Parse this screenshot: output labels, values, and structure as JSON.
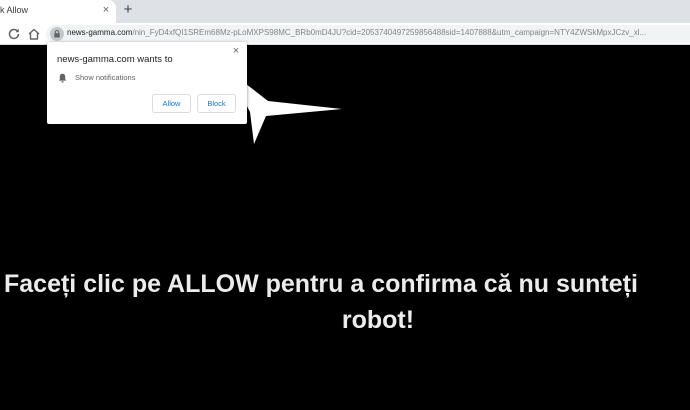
{
  "tab": {
    "title": "k Allow",
    "close_glyph": "×",
    "new_tab_glyph": "+"
  },
  "address_bar": {
    "host": "news-gamma.com",
    "path": "/nin_FyD4xfQI1SREm68Mz-pLoMXPS98MC_BRb0mD4JU?cid=2053740497259856488sid=1407888&utm_campaign=NTY4ZWSkMpxJCzv_xl..."
  },
  "icons": [
    "reload-icon",
    "home-icon",
    "lock-icon",
    "bell-icon",
    "close-icon"
  ],
  "popup": {
    "title": "news-gamma.com wants to",
    "permission": "Show notifications",
    "allow_label": "Allow",
    "block_label": "Block",
    "close_glyph": "×"
  },
  "page": {
    "message_line1": "Faceți clic pe ALLOW pentru a confirma că nu sunteți",
    "message_line2": "robot!"
  },
  "colors": {
    "page_bg": "#000000",
    "message": "#ececec",
    "button_text": "#1a73e8",
    "arrow": "#ffffff"
  }
}
